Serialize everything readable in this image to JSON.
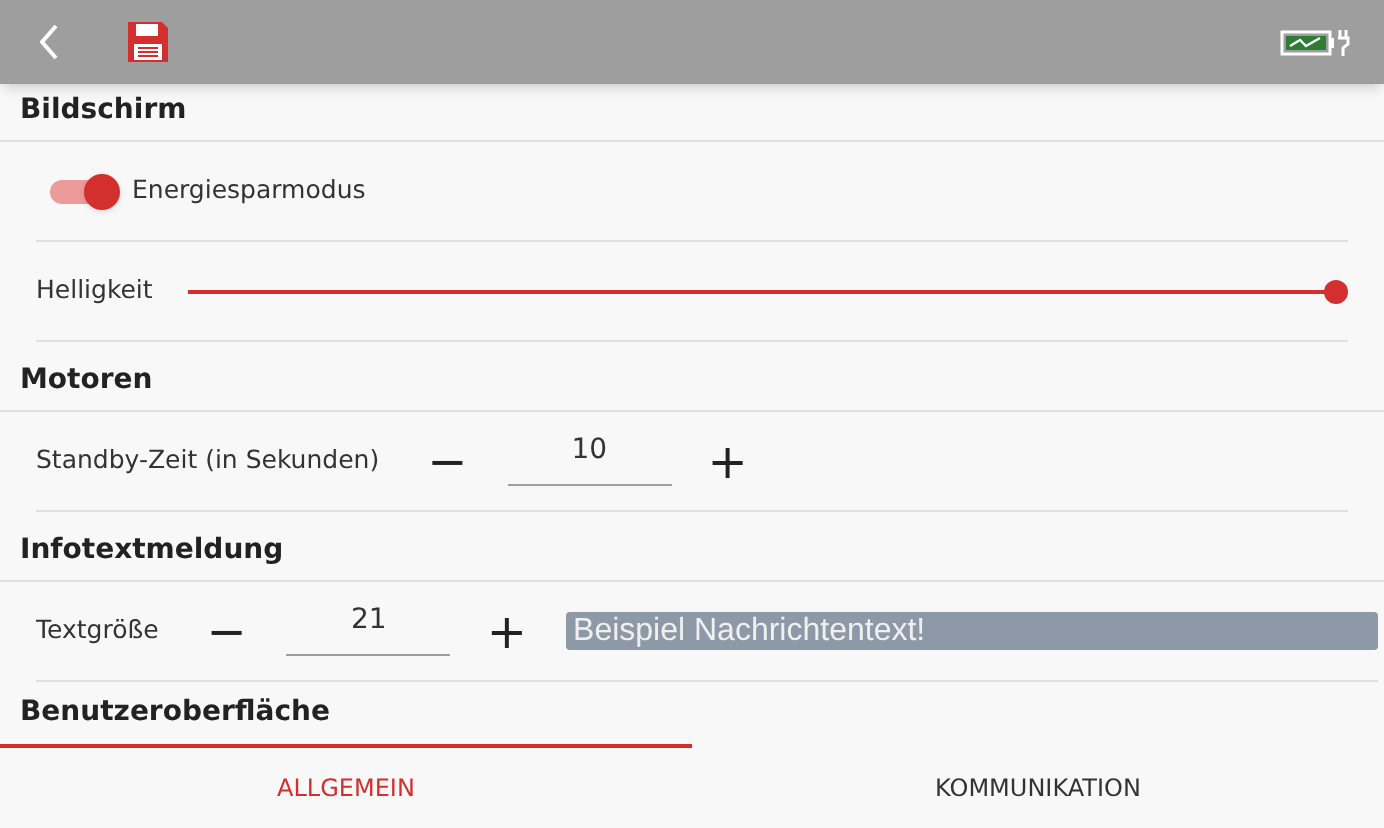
{
  "sections": [
    {
      "title": "Bildschirm",
      "rows": [
        {
          "kind": "toggle",
          "label": "Energiesparmodus",
          "on": true
        },
        {
          "kind": "slider",
          "label": "Helligkeit",
          "level": 1
        }
      ]
    },
    {
      "title": "Motoren",
      "rows": [
        {
          "kind": "stepper",
          "label": "Standby-Zeit (in Sekunden)",
          "minus": "−",
          "value": "10",
          "plus": "+"
        }
      ]
    },
    {
      "title": "Infotextmeldung",
      "rows": [
        {
          "kind": "stepper",
          "label": "Textgröße",
          "minus": "−",
          "value": "21",
          "plus": "+",
          "preview": "Beispiel Nachrichtentext!"
        }
      ]
    },
    {
      "title": "Benutzeroberfläche"
    }
  ],
  "tabs": [
    {
      "label": "ALLGEMEIN",
      "selected": true
    },
    {
      "label": "KOMMUNIKATION",
      "selected": false
    }
  ]
}
